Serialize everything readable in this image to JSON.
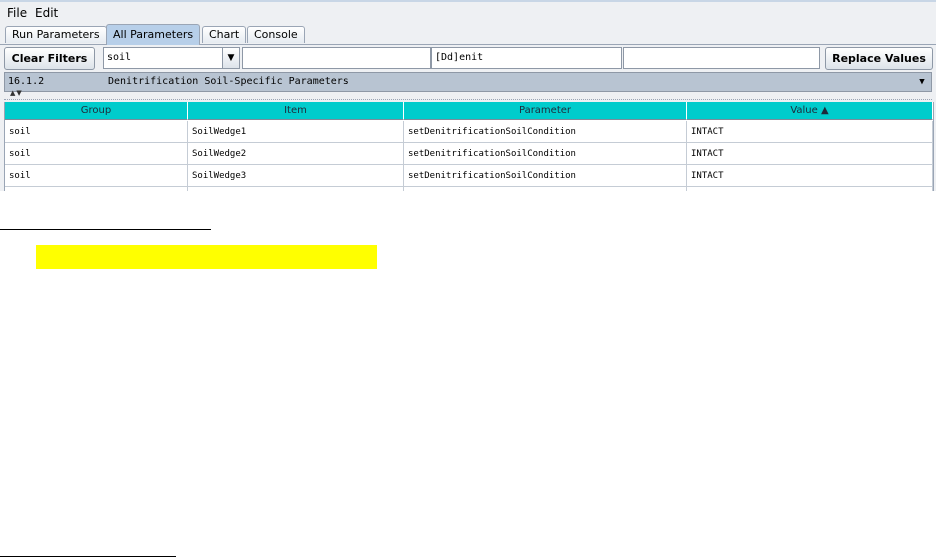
{
  "menubar": {
    "items": [
      "File",
      "Edit"
    ]
  },
  "tabs": [
    {
      "label": "Run Parameters",
      "active": false
    },
    {
      "label": "All Parameters",
      "active": true
    },
    {
      "label": "Chart",
      "active": false
    },
    {
      "label": "Console",
      "active": false
    }
  ],
  "filters": {
    "clear_label": "Clear Filters",
    "group_value": "soil",
    "item_value": "",
    "parameter_value": "[Dd]enit",
    "value_value": "",
    "replace_label": "Replace Values"
  },
  "section": {
    "number": "16.1.2",
    "title": "Denitrification Soil-Specific Parameters"
  },
  "table": {
    "columns": [
      "Group",
      "Item",
      "Parameter",
      "Value ▲"
    ],
    "rows": [
      [
        "soil",
        "SoilWedge1",
        "setDenitrificationSoilCondition",
        "INTACT"
      ],
      [
        "soil",
        "SoilWedge2",
        "setDenitrificationSoilCondition",
        "INTACT"
      ],
      [
        "soil",
        "SoilWedge3",
        "setDenitrificationSoilCondition",
        "INTACT"
      ]
    ]
  },
  "colors": {
    "header_bg": "#00cccc",
    "highlight": "#ffff00",
    "section_bg": "#b8c4d2",
    "active_tab": "#b7cfe9"
  }
}
